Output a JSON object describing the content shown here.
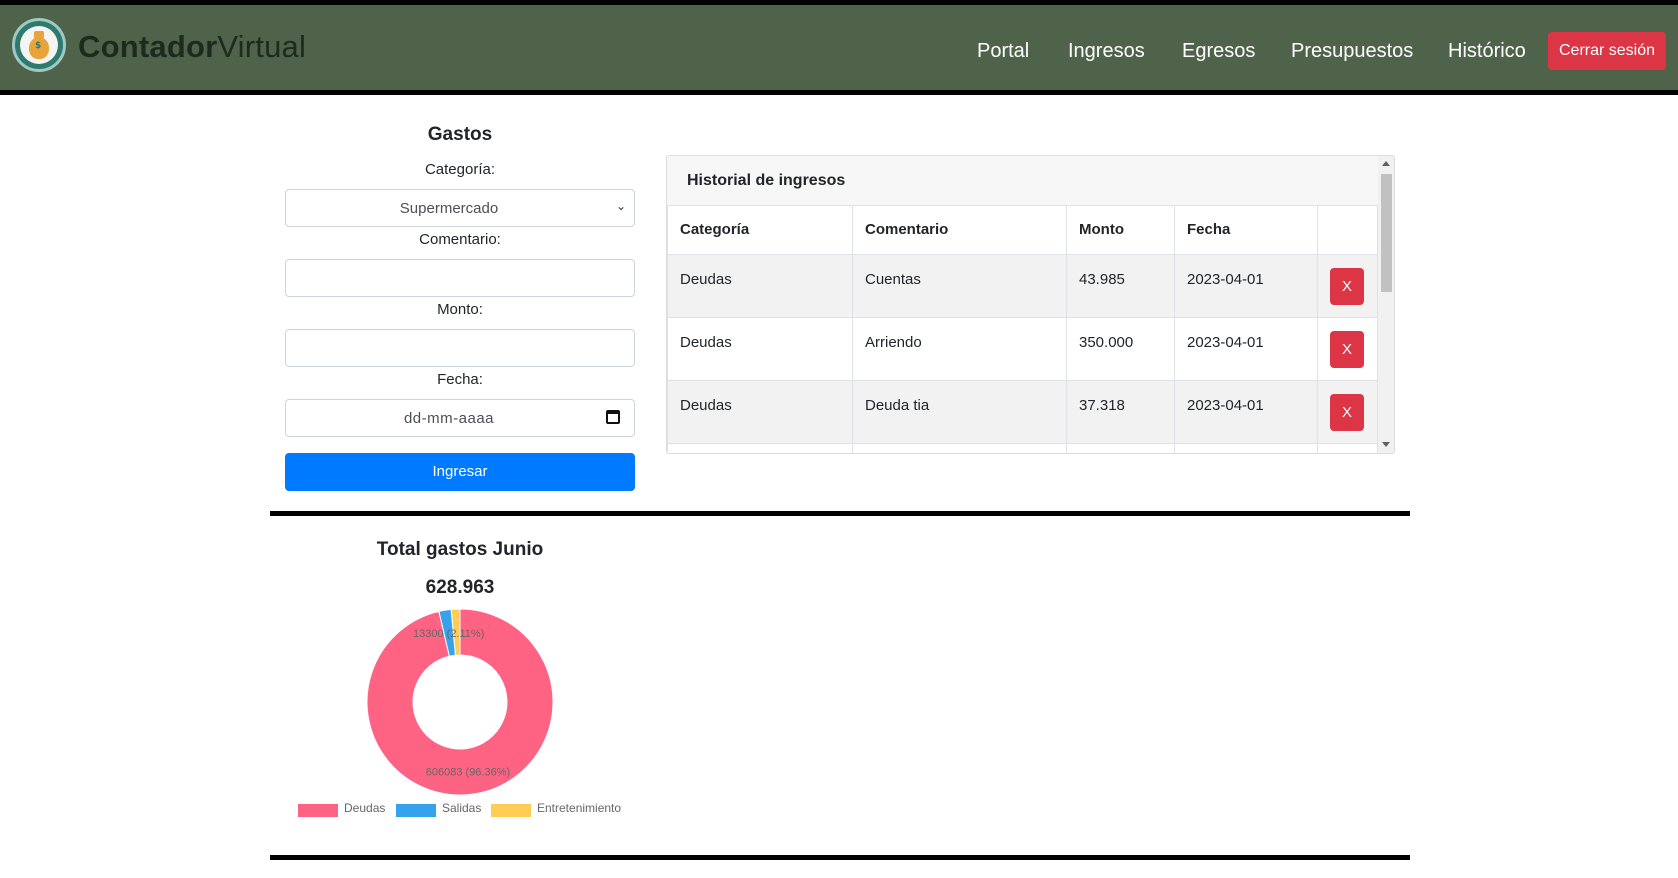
{
  "header": {
    "brand_bold": "Contador",
    "brand_light": "Virtual",
    "nav": [
      "Portal",
      "Ingresos",
      "Egresos",
      "Presupuestos",
      "Histórico"
    ],
    "logout": "Cerrar sesión",
    "logo_symbol": "$"
  },
  "form": {
    "title": "Gastos",
    "category_label": "Categoría:",
    "category_value": "Supermercado",
    "comment_label": "Comentario:",
    "comment_value": "",
    "amount_label": "Monto:",
    "amount_value": "",
    "date_label": "Fecha:",
    "date_placeholder": "dd-mm-aaaa",
    "submit": "Ingresar"
  },
  "history": {
    "title": "Historial de ingresos",
    "columns": [
      "Categoría",
      "Comentario",
      "Monto",
      "Fecha",
      ""
    ],
    "rows": [
      {
        "category": "Deudas",
        "comment": "Cuentas",
        "amount": "43.985",
        "date": "2023-04-01",
        "delete": "X"
      },
      {
        "category": "Deudas",
        "comment": "Arriendo",
        "amount": "350.000",
        "date": "2023-04-01",
        "delete": "X"
      },
      {
        "category": "Deudas",
        "comment": "Deuda tia",
        "amount": "37.318",
        "date": "2023-04-01",
        "delete": "X"
      }
    ]
  },
  "summary": {
    "title": "Total gastos Junio",
    "total": "628.963"
  },
  "chart_data": {
    "type": "pie",
    "title": "",
    "categories": [
      "Deudas",
      "Salidas",
      "Entretenimiento"
    ],
    "values": [
      606083,
      13300,
      9580
    ],
    "colors": [
      "#ff6384",
      "#36a2eb",
      "#ffcd56"
    ],
    "labels": [
      "606083 (96.36%)",
      "13300 (2.11%)",
      ""
    ],
    "legend": "bottom"
  }
}
